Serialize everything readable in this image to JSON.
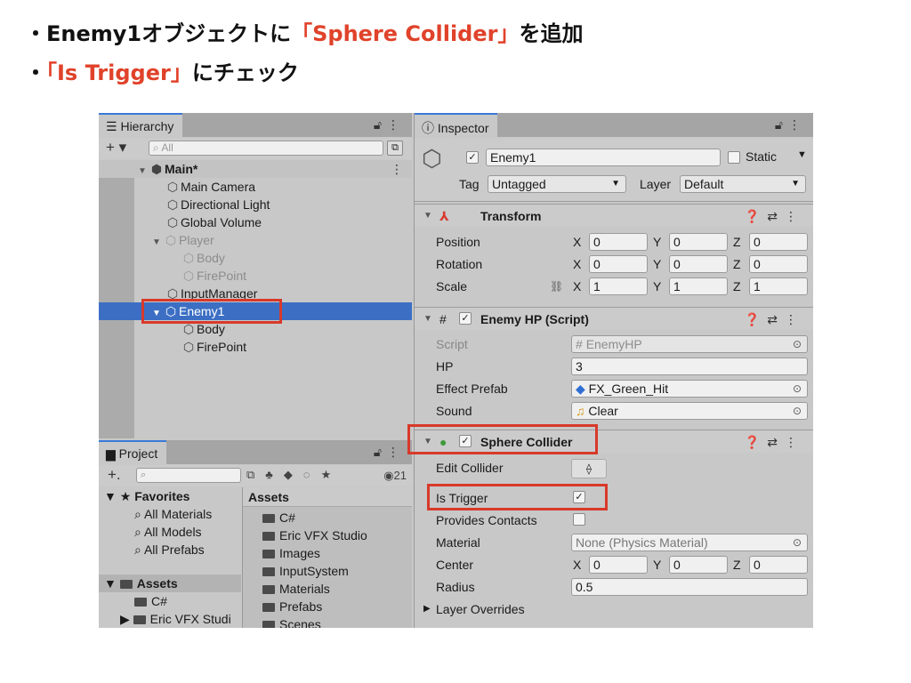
{
  "slide": {
    "line1": {
      "bullet": "・",
      "prefix": "Enemy1オブジェクトに",
      "highlight": "「Sphere Collider」",
      "suffix": "を追加"
    },
    "line2": {
      "bullet": "・",
      "highlight": "「Is Trigger」",
      "suffix": "にチェック"
    }
  },
  "colors": {
    "highlight_text": "#e0422a",
    "red_box": "#d8392a",
    "selection": "#3c6fc4"
  },
  "hierarchy": {
    "tab_label": "Hierarchy",
    "search_placeholder": "All",
    "scene_name": "Main*",
    "items": [
      {
        "label": "Main Camera",
        "icon": "gameobject-icon"
      },
      {
        "label": "Directional Light",
        "icon": "gameobject-icon"
      },
      {
        "label": "Global Volume",
        "icon": "gameobject-icon"
      },
      {
        "label": "Player",
        "icon": "prefab-icon"
      },
      {
        "label": "Body",
        "icon": "prefab-icon"
      },
      {
        "label": "FirePoint",
        "icon": "prefab-icon"
      },
      {
        "label": "InputManager",
        "icon": "gameobject-icon"
      },
      {
        "label": "Enemy1",
        "icon": "gameobject-icon",
        "selected": true
      },
      {
        "label": "Body",
        "icon": "gameobject-icon"
      },
      {
        "label": "FirePoint",
        "icon": "gameobject-icon"
      }
    ]
  },
  "project": {
    "tab_label": "Project",
    "hidden_count": "21",
    "favorites_label": "Favorites",
    "favorites": [
      "All Materials",
      "All Models",
      "All Prefabs"
    ],
    "assets_label": "Assets",
    "assets_tree": [
      "C#",
      "Eric VFX Studi"
    ],
    "assets_header": "Assets",
    "assets_list": [
      "C#",
      "Eric VFX Studio",
      "Images",
      "InputSystem",
      "Materials",
      "Prefabs",
      "Scenes"
    ]
  },
  "inspector": {
    "tab_label": "Inspector",
    "object_name": "Enemy1",
    "static_label": "Static",
    "tag_label": "Tag",
    "tag_value": "Untagged",
    "layer_label": "Layer",
    "layer_value": "Default",
    "transform": {
      "title": "Transform",
      "position_label": "Position",
      "position": {
        "x": "0",
        "y": "0",
        "z": "0"
      },
      "rotation_label": "Rotation",
      "rotation": {
        "x": "0",
        "y": "0",
        "z": "0"
      },
      "scale_label": "Scale",
      "scale": {
        "x": "1",
        "y": "1",
        "z": "1"
      }
    },
    "enemy_hp": {
      "title": "Enemy HP (Script)",
      "script_label": "Script",
      "script_value": "EnemyHP",
      "hp_label": "HP",
      "hp_value": "3",
      "effect_label": "Effect Prefab",
      "effect_value": "FX_Green_Hit",
      "sound_label": "Sound",
      "sound_value": "Clear"
    },
    "sphere_collider": {
      "title": "Sphere Collider",
      "edit_label": "Edit Collider",
      "trigger_label": "Is Trigger",
      "trigger_checked": true,
      "contacts_label": "Provides Contacts",
      "contacts_checked": false,
      "material_label": "Material",
      "material_value": "None (Physics Material)",
      "center_label": "Center",
      "center": {
        "x": "0",
        "y": "0",
        "z": "0"
      },
      "radius_label": "Radius",
      "radius_value": "0.5",
      "overrides_label": "Layer Overrides"
    },
    "axis_labels": {
      "x": "X",
      "y": "Y",
      "z": "Z"
    }
  }
}
